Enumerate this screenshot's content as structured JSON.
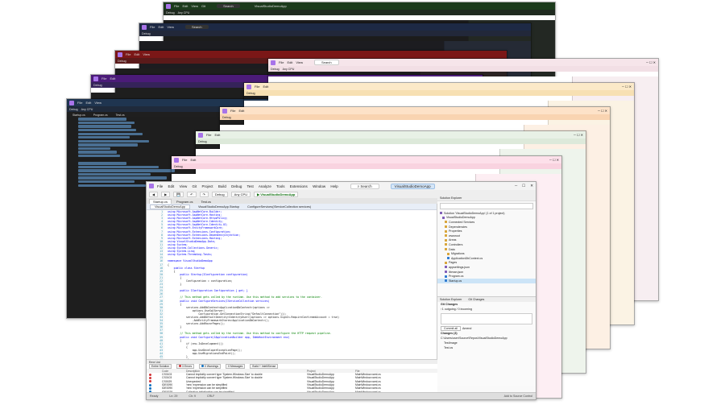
{
  "menu": [
    "File",
    "Edit",
    "View",
    "Git",
    "Project",
    "Build",
    "Debug",
    "Test",
    "Analyze",
    "Tools",
    "Extensions",
    "Window",
    "Help"
  ],
  "search_label": "Search",
  "project_name": "VisualStudioDemoApp",
  "toolbar": {
    "config": "Debug",
    "platform": "Any CPU",
    "run": "▶ VisualStudioDemoApp"
  },
  "doc_tabs": [
    "Startup.cs",
    "Program.cs",
    "Test.cs"
  ],
  "editor_tabs": [
    "VisualStudioDemoApp",
    "VisualStudioDemoApp.Startup",
    "ConfigureServices(IServiceCollection services)"
  ],
  "code_lines": [
    "using Microsoft.AspNetCore.Builder;",
    "using Microsoft.AspNetCore.Hosting;",
    "using Microsoft.AspNetCore.HttpsPolicy;",
    "using Microsoft.AspNetCore.Identity;",
    "using Microsoft.AspNetCore.Identity.UI;",
    "using Microsoft.EntityFrameworkCore;",
    "using Microsoft.Extensions.Configuration;",
    "using Microsoft.Extensions.DependencyInjection;",
    "using Microsoft.Extensions.Hosting;",
    "using VisualStudioDemoApp.Data;",
    "using System;",
    "using System.Collections.Generic;",
    "using System.Linq;",
    "using System.Threading.Tasks;",
    "",
    "namespace VisualStudioDemoApp",
    "{",
    "    public class Startup",
    "    {",
    "        public Startup(IConfiguration configuration)",
    "        {",
    "            Configuration = configuration;",
    "        }",
    "",
    "        public IConfiguration Configuration { get; }",
    "",
    "        // This method gets called by the runtime. Use this method to add services to the container.",
    "        public void ConfigureServices(IServiceCollection services)",
    "        {",
    "            services.AddDbContext<ApplicationDbContext>(options =>",
    "                options.UseSqlServer(",
    "                    Configuration.GetConnectionString(\"DefaultConnection\")));",
    "            services.AddDefaultIdentity<IdentityUser>(options => options.SignIn.RequireConfirmedAccount = true)",
    "                .AddEntityFrameworkStores<ApplicationDbContext>();",
    "            services.AddRazorPages();",
    "        }",
    "",
    "        // This method gets called by the runtime. Use this method to configure the HTTP request pipeline.",
    "        public void Configure(IApplicationBuilder app, IWebHostEnvironment env)",
    "        {",
    "            if (env.IsDevelopment())",
    "            {",
    "                app.UseDeveloperExceptionPage();",
    "                app.UseMigrationsEndPoint();",
    "            }",
    "            else"
  ],
  "solution_explorer": {
    "title": "Solution Explorer",
    "items": [
      "Solution 'VisualStudioDemoApp' (1 of 1 project)",
      "VisualStudioDemoApp",
      "Connected Services",
      "Dependencies",
      "Properties",
      "wwwroot",
      "Areas",
      "Controllers",
      "Data",
      "Migrations",
      "ApplicationDbContext.cs",
      "Pages",
      "appsettings.json",
      "libman.json",
      "Program.cs",
      "Startup.cs"
    ],
    "tabs": [
      "Solution Explorer",
      "Git Changes"
    ]
  },
  "git_changes": {
    "title": "Git Changes",
    "branch": "↑1 outgoing / 0 incoming",
    "commit_all": "Commit all",
    "amend": "Amend",
    "changes": "Changes (3)",
    "files": [
      "C:\\Users\\user\\Source\\Repos\\VisualStudioDemoApp",
      "TestImage",
      "Test.cs"
    ]
  },
  "error_list": {
    "title": "Error List",
    "scope": "Entire Solution",
    "errors": "3 Errors",
    "warnings": "0 Warnings",
    "messages": "0 Messages",
    "build": "Build + IntelliSense",
    "headers": [
      "",
      "Code",
      "Description",
      "Project",
      "File"
    ],
    "rows": [
      {
        "kind": "e",
        "code": "CS0103",
        "desc": "Cannot implicitly convert type 'System.Windows.Size' to double",
        "project": "VisualStudioDemoApp",
        "file": "MainWindow.xaml.cs"
      },
      {
        "kind": "e",
        "code": "CS0103",
        "desc": "Cannot implicitly convert type 'System.Windows.Size' to double",
        "project": "VisualStudioDemoApp",
        "file": "MainWindow.xaml.cs"
      },
      {
        "kind": "e",
        "code": "CS0029",
        "desc": "Unexpected",
        "project": "VisualStudioDemoApp",
        "file": "MainWindow.xaml.cs"
      },
      {
        "kind": "w",
        "code": "IDE0090",
        "desc": "'new' expression can be simplified",
        "project": "VisualStudioDemoApp",
        "file": "MainWindow.xaml.cs"
      },
      {
        "kind": "w",
        "code": "IDE0090",
        "desc": "'new' expression can be simplified",
        "project": "VisualStudioDemoApp",
        "file": "MainWindow.xaml.cs"
      },
      {
        "kind": "w",
        "code": "IDE0028",
        "desc": "Collection initialization can be simplified",
        "project": "VisualStudioDemoApp",
        "file": "MainWindow.xaml.cs"
      }
    ]
  },
  "status": {
    "ready": "Ready",
    "ln": "Ln: 29",
    "ch": "Ch: 9",
    "enc": "CRLF",
    "add_source": "Add to Source Control"
  },
  "windows": [
    {
      "title_bg": "#1c3b1c",
      "tool_bg": "#1f2a1f",
      "side": "#232823",
      "editor": "#1c1c1c"
    },
    {
      "title_bg": "#1d2944",
      "tool_bg": "#22283a",
      "side": "#252a35",
      "editor": "#1c1c20"
    },
    {
      "title_bg": "#7b1717",
      "tool_bg": "#5a1a1a",
      "side": "#2b2323",
      "editor": "#1e1e1e"
    },
    {
      "title_bg": "#4b1b78",
      "tool_bg": "#35235a",
      "side": "#262130",
      "editor": "#1e1e1e"
    },
    {
      "title_bg": "#1f3550",
      "tool_bg": "#1f2a3b",
      "side": "#252526",
      "editor": "#1e1e1e"
    },
    {
      "title_bg": "#f6e5ea",
      "tool_bg": "#f2dfe5",
      "side": "#f7eef1",
      "editor": "#ffffff"
    },
    {
      "title_bg": "#fbe9c8",
      "tool_bg": "#f7e0b3",
      "side": "#fbf3e4",
      "editor": "#ffffff"
    },
    {
      "title_bg": "#fde2c8",
      "tool_bg": "#f9d4b1",
      "side": "#fdf0e4",
      "editor": "#ffffff"
    },
    {
      "title_bg": "#e8f1e6",
      "tool_bg": "#dde9da",
      "side": "#eef4ec",
      "editor": "#ffffff"
    },
    {
      "title_bg": "#fde0ea",
      "tool_bg": "#f9d3e0",
      "side": "#fdeef3",
      "editor": "#ffffff"
    }
  ]
}
